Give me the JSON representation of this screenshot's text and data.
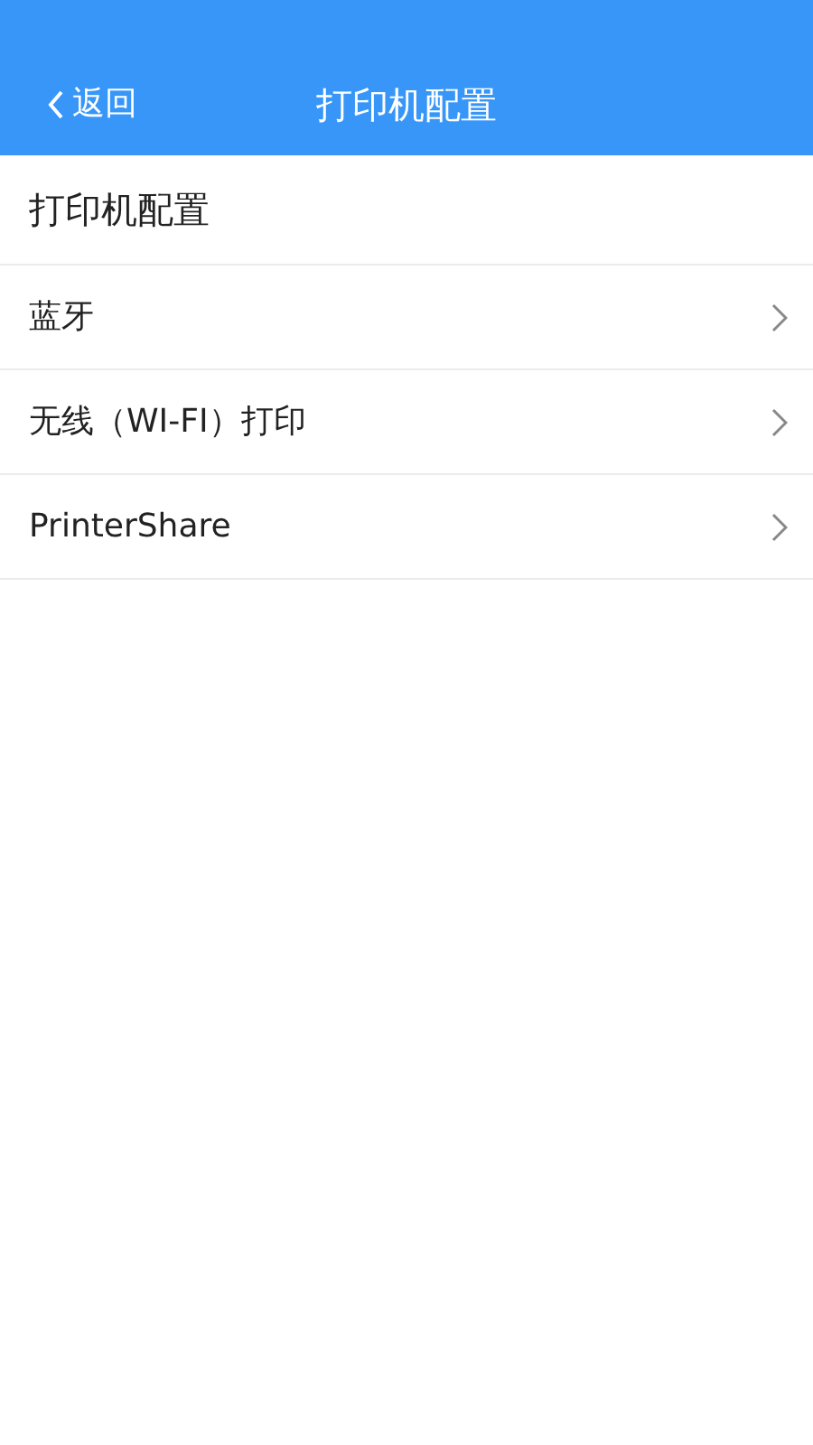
{
  "header": {
    "back": "返回",
    "title": "打印机配置"
  },
  "section_title": "打印机配置",
  "items": [
    {
      "label": "蓝牙"
    },
    {
      "label": "无线（WI-FI）打印"
    },
    {
      "label": "PrinterShare"
    }
  ]
}
